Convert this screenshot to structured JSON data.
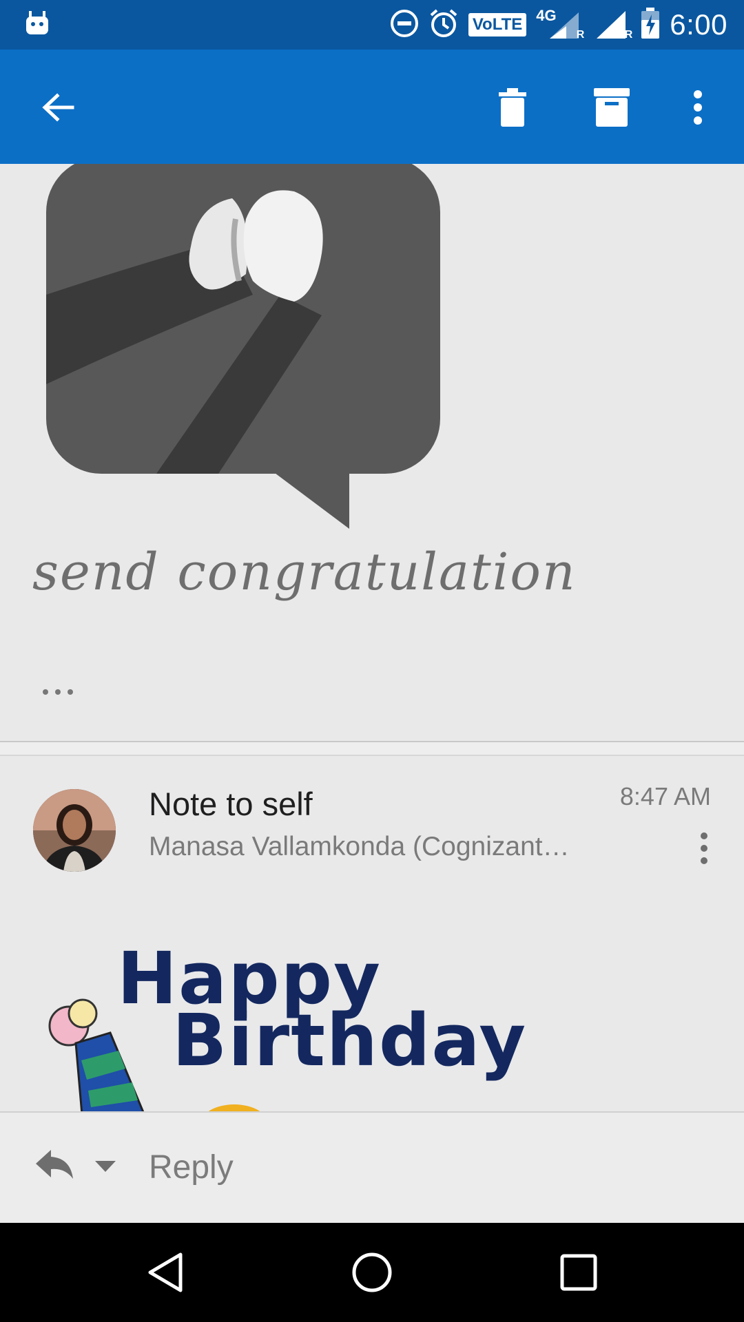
{
  "status_bar": {
    "time": "6:00",
    "volte": "VoLTE",
    "network": "4G",
    "roaming": "R",
    "icons": [
      "android-icon",
      "dnd-icon",
      "alarm-icon",
      "volte-icon",
      "signal-icon",
      "battery-icon"
    ]
  },
  "app_bar": {
    "back": "arrow-back-icon",
    "delete": "trash-icon",
    "archive": "archive-icon",
    "more": "more-vert-icon"
  },
  "image_card": {
    "caption": "send congratulation"
  },
  "message": {
    "sender": "Note to self",
    "subject": "Manasa Vallamkonda (Cognizant…",
    "time": "8:47 AM"
  },
  "birthday": {
    "line1": "Happy",
    "line2": "Birthday"
  },
  "reply_bar": {
    "label": "Reply"
  },
  "colors": {
    "status_bar": "#0a57a0",
    "app_bar": "#0b6fc6",
    "background": "#e9e9ea"
  }
}
